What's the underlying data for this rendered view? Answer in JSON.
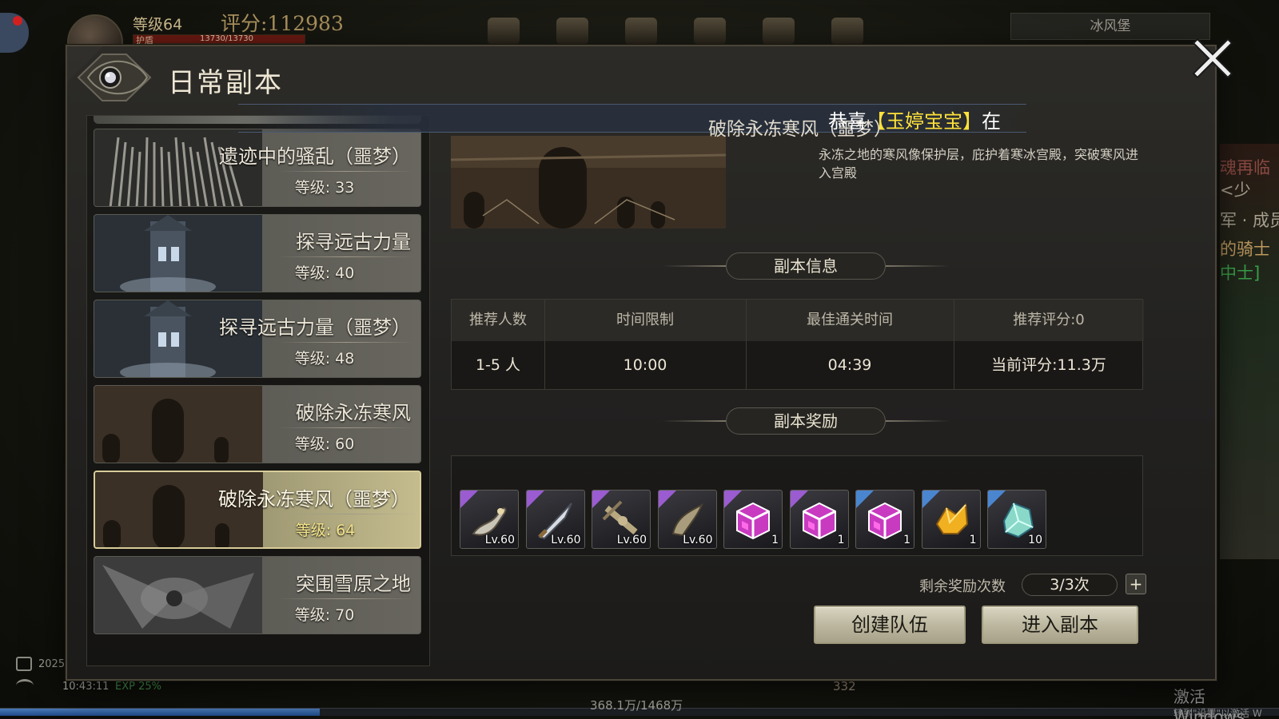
{
  "hud": {
    "level": "等级64",
    "score": "评分:112983",
    "hp_label": "护盾",
    "hp_text": "13730/13730",
    "location": "冰风堡",
    "clock_date": "2025",
    "clock_time": "10:43:11",
    "exp_percent": "EXP 25%",
    "exp_fill_fraction": 0.25,
    "currency_text": "368.1万/1468万",
    "hp_bottom": "332",
    "right_side_texts": [
      "魂再临",
      "<少",
      "军 · 成员",
      "的骑士",
      "中士]"
    ],
    "windows_activate": "激活 Windows",
    "windows_activate_sub": "转到\"设置\"以激活 W"
  },
  "dialog": {
    "title": "日常副本",
    "close_icon": "close-x-icon"
  },
  "dungeons": [
    {
      "name": "遗迹中的骚乱（噩梦）",
      "level": "等级: 33",
      "theme": "spikes"
    },
    {
      "name": "探寻远古力量",
      "level": "等级: 40",
      "theme": "tower"
    },
    {
      "name": "探寻远古力量（噩梦）",
      "level": "等级: 48",
      "theme": "tower"
    },
    {
      "name": "破除永冻寒风",
      "level": "等级: 60",
      "theme": "castle"
    },
    {
      "name": "破除永冻寒风（噩梦）",
      "level": "等级: 64",
      "theme": "castle",
      "selected": true
    },
    {
      "name": "突围雪原之地",
      "level": "等级: 70",
      "theme": "wing"
    }
  ],
  "detail": {
    "stage_name": "破除永冻寒风（噩梦）",
    "announce_prefix": "恭喜",
    "announce_highlight": "【玉婷宝宝】",
    "announce_suffix": "在",
    "description": "永冻之地的寒风像保护层，庇护着寒冰宫殿，突破寒风进入宫殿",
    "info_header": "副本信息",
    "reward_header": "副本奖励",
    "table_headers": [
      "推荐人数",
      "时间限制",
      "最佳通关时间",
      "推荐评分:0"
    ],
    "table_values": [
      "1-5 人",
      "10:00",
      "04:39",
      "当前评分:11.3万"
    ],
    "rewards": [
      {
        "icon": "scorpion-weapon-icon",
        "label": "Lv.60",
        "rarity": "purple"
      },
      {
        "icon": "blade-weapon-icon",
        "label": "Lv.60",
        "rarity": "purple"
      },
      {
        "icon": "crossbow-weapon-icon",
        "label": "Lv.60",
        "rarity": "purple"
      },
      {
        "icon": "claw-weapon-icon",
        "label": "Lv.60",
        "rarity": "purple"
      },
      {
        "icon": "purple-chest-icon",
        "label": "1",
        "rarity": "purple"
      },
      {
        "icon": "purple-chest-icon",
        "label": "1",
        "rarity": "purple"
      },
      {
        "icon": "purple-chest-icon",
        "label": "1",
        "rarity": "blue"
      },
      {
        "icon": "gold-ore-icon",
        "label": "1",
        "rarity": "blue"
      },
      {
        "icon": "crystal-shard-icon",
        "label": "10",
        "rarity": "blue"
      }
    ],
    "remaining_label": "剩余奖励次数",
    "remaining_value": "3/3次",
    "plus_label": "+",
    "create_team": "创建队伍",
    "enter_dungeon": "进入副本"
  },
  "colors": {
    "selected_level": "#f4e48a",
    "announce_highlight": "#ffe23a",
    "epic": "#9a5cd0",
    "rare": "#4a86d0"
  }
}
